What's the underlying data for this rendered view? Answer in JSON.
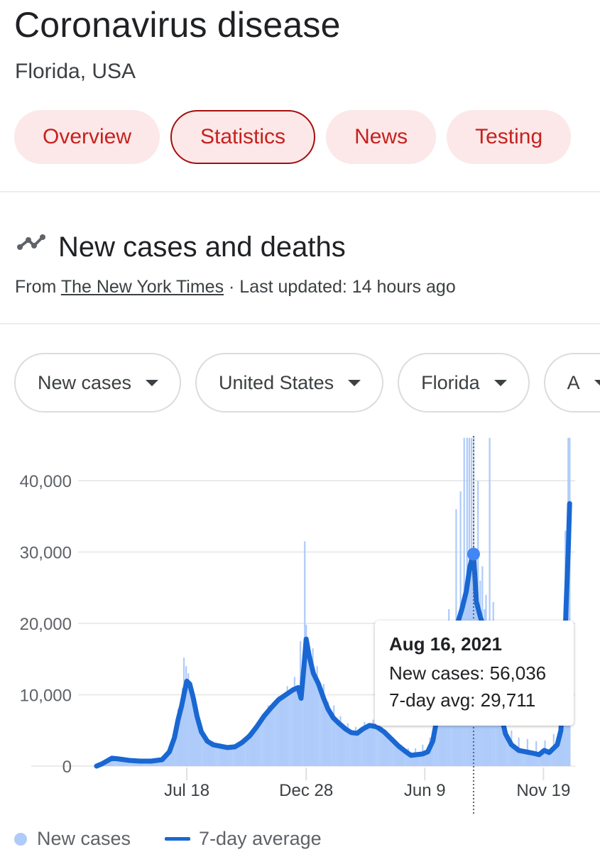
{
  "header": {
    "title": "Coronavirus disease",
    "subtitle": "Florida, USA"
  },
  "tabs": [
    {
      "label": "Overview",
      "active": false
    },
    {
      "label": "Statistics",
      "active": true
    },
    {
      "label": "News",
      "active": false
    },
    {
      "label": "Testing",
      "active": false
    }
  ],
  "section": {
    "icon": "trending-line-icon",
    "title": "New cases and deaths",
    "source_prefix": "From ",
    "source_link": "The New York Times",
    "source_suffix": " · Last updated: 14 hours ago"
  },
  "filters": [
    {
      "label": "New cases",
      "icon": "caret-down-icon"
    },
    {
      "label": "United States",
      "icon": "caret-down-icon"
    },
    {
      "label": "Florida",
      "icon": "caret-down-icon"
    },
    {
      "label": "A",
      "icon": "caret-down-icon"
    }
  ],
  "tooltip": {
    "date": "Aug 16, 2021",
    "new_cases_label": "New cases: 56,036",
    "avg_label": "7-day avg: 29,711"
  },
  "legend": {
    "bars": "New cases",
    "line": "7-day average"
  },
  "colors": {
    "tab_bg": "#fce8e8",
    "tab_text": "#c5221f",
    "bar": "#aecbfa",
    "line": "#1967d2",
    "highlight": "#4285f4"
  },
  "chart_data": {
    "type": "bar",
    "title": "New cases",
    "xlabel": "",
    "ylabel": "",
    "ylim": [
      0,
      46000
    ],
    "yticks": [
      0,
      10000,
      20000,
      30000,
      40000
    ],
    "ytick_labels": [
      "0",
      "10,000",
      "20,000",
      "30,000",
      "40,000"
    ],
    "xticks": [
      {
        "label": "Jul 18",
        "day": 124
      },
      {
        "label": "Dec 28",
        "day": 288
      },
      {
        "label": "Jun 9",
        "day": 451
      },
      {
        "label": "Nov 19",
        "day": 614
      }
    ],
    "x_start": "Mar 16, 2020",
    "x_days_total": 658,
    "grid": true,
    "legend_position": "bottom-left",
    "highlight": {
      "date": "Aug 16, 2021",
      "day": 518,
      "new_cases": 56036,
      "avg": 29711
    },
    "series": [
      {
        "name": "7-day average",
        "type": "line",
        "points": [
          [
            0,
            0
          ],
          [
            7,
            300
          ],
          [
            14,
            700
          ],
          [
            21,
            1100
          ],
          [
            30,
            1000
          ],
          [
            45,
            800
          ],
          [
            60,
            700
          ],
          [
            75,
            700
          ],
          [
            90,
            900
          ],
          [
            100,
            2000
          ],
          [
            107,
            4000
          ],
          [
            112,
            6500
          ],
          [
            117,
            8500
          ],
          [
            121,
            10500
          ],
          [
            124,
            11900
          ],
          [
            128,
            11500
          ],
          [
            133,
            9500
          ],
          [
            138,
            7000
          ],
          [
            144,
            4800
          ],
          [
            152,
            3500
          ],
          [
            160,
            3000
          ],
          [
            170,
            2800
          ],
          [
            180,
            2600
          ],
          [
            190,
            2700
          ],
          [
            200,
            3300
          ],
          [
            210,
            4200
          ],
          [
            220,
            5500
          ],
          [
            230,
            7000
          ],
          [
            240,
            8200
          ],
          [
            250,
            9300
          ],
          [
            260,
            10000
          ],
          [
            270,
            10700
          ],
          [
            277,
            11000
          ],
          [
            281,
            9500
          ],
          [
            285,
            14000
          ],
          [
            288,
            17800
          ],
          [
            292,
            15500
          ],
          [
            298,
            13000
          ],
          [
            305,
            11500
          ],
          [
            312,
            9500
          ],
          [
            318,
            8000
          ],
          [
            325,
            6800
          ],
          [
            333,
            6000
          ],
          [
            342,
            5200
          ],
          [
            350,
            4700
          ],
          [
            358,
            4600
          ],
          [
            366,
            5200
          ],
          [
            375,
            5700
          ],
          [
            385,
            5500
          ],
          [
            395,
            4800
          ],
          [
            405,
            3800
          ],
          [
            415,
            2800
          ],
          [
            425,
            2000
          ],
          [
            432,
            1500
          ],
          [
            440,
            1600
          ],
          [
            448,
            1700
          ],
          [
            455,
            2000
          ],
          [
            462,
            3500
          ],
          [
            470,
            8000
          ],
          [
            478,
            12000
          ],
          [
            488,
            17000
          ],
          [
            496,
            20000
          ],
          [
            502,
            22000
          ],
          [
            508,
            24500
          ],
          [
            513,
            28000
          ],
          [
            518,
            29711
          ],
          [
            522,
            23000
          ],
          [
            527,
            21000
          ],
          [
            533,
            19000
          ],
          [
            540,
            16000
          ],
          [
            548,
            11500
          ],
          [
            555,
            7500
          ],
          [
            562,
            4500
          ],
          [
            570,
            3000
          ],
          [
            580,
            2200
          ],
          [
            590,
            2000
          ],
          [
            600,
            1800
          ],
          [
            608,
            1600
          ],
          [
            615,
            2200
          ],
          [
            622,
            1900
          ],
          [
            628,
            2500
          ],
          [
            633,
            3000
          ],
          [
            638,
            5000
          ],
          [
            642,
            12000
          ],
          [
            645,
            22000
          ],
          [
            648,
            30000
          ],
          [
            650,
            36800
          ]
        ]
      },
      {
        "name": "New cases",
        "type": "bar",
        "points": [
          [
            10,
            500
          ],
          [
            30,
            1300
          ],
          [
            60,
            900
          ],
          [
            90,
            1400
          ],
          [
            105,
            4500
          ],
          [
            112,
            8000
          ],
          [
            118,
            11000
          ],
          [
            120,
            15200
          ],
          [
            123,
            14000
          ],
          [
            126,
            13000
          ],
          [
            130,
            9500
          ],
          [
            136,
            7000
          ],
          [
            140,
            5500
          ],
          [
            148,
            4000
          ],
          [
            160,
            3500
          ],
          [
            172,
            3000
          ],
          [
            184,
            2800
          ],
          [
            196,
            3200
          ],
          [
            208,
            4500
          ],
          [
            222,
            6200
          ],
          [
            236,
            8500
          ],
          [
            250,
            9800
          ],
          [
            262,
            11200
          ],
          [
            272,
            12500
          ],
          [
            280,
            17500
          ],
          [
            286,
            31500
          ],
          [
            288,
            19800
          ],
          [
            292,
            16000
          ],
          [
            297,
            16500
          ],
          [
            303,
            14000
          ],
          [
            312,
            11500
          ],
          [
            318,
            9000
          ],
          [
            326,
            8500
          ],
          [
            335,
            7000
          ],
          [
            345,
            6000
          ],
          [
            356,
            5500
          ],
          [
            368,
            6200
          ],
          [
            380,
            6500
          ],
          [
            392,
            5500
          ],
          [
            404,
            4200
          ],
          [
            418,
            3000
          ],
          [
            428,
            2500
          ],
          [
            438,
            2500
          ],
          [
            448,
            3000
          ],
          [
            458,
            4000
          ],
          [
            466,
            7000
          ],
          [
            474,
            12000
          ],
          [
            484,
            22000
          ],
          [
            494,
            36000
          ],
          [
            500,
            38500
          ],
          [
            505,
            46000
          ],
          [
            509,
            46000
          ],
          [
            512,
            46000
          ],
          [
            515,
            46000
          ],
          [
            518,
            56036
          ],
          [
            521,
            30000
          ],
          [
            524,
            40000
          ],
          [
            527,
            26000
          ],
          [
            530,
            28000
          ],
          [
            533,
            22000
          ],
          [
            535,
            24000
          ],
          [
            540,
            46000
          ],
          [
            545,
            23000
          ],
          [
            552,
            13000
          ],
          [
            560,
            8000
          ],
          [
            570,
            5000
          ],
          [
            580,
            4000
          ],
          [
            592,
            3800
          ],
          [
            604,
            3500
          ],
          [
            616,
            3600
          ],
          [
            628,
            4500
          ],
          [
            638,
            8000
          ],
          [
            644,
            33000
          ],
          [
            648,
            46000
          ],
          [
            650,
            46000
          ]
        ]
      }
    ]
  }
}
